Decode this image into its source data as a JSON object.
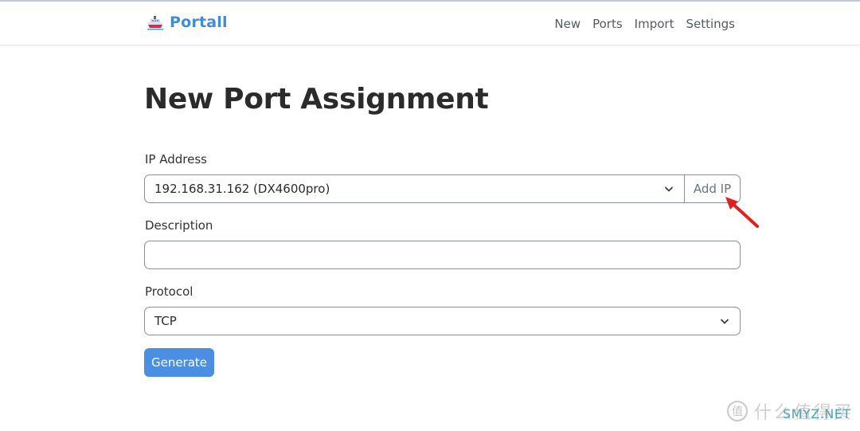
{
  "navbar": {
    "brand": {
      "icon": "ship-icon",
      "label": "Portall"
    },
    "links": [
      {
        "label": "New"
      },
      {
        "label": "Ports"
      },
      {
        "label": "Import"
      },
      {
        "label": "Settings"
      }
    ]
  },
  "page": {
    "title": "New Port Assignment"
  },
  "form": {
    "ip_address": {
      "label": "IP Address",
      "selected": "192.168.31.162 (DX4600pro)",
      "add_button": "Add IP"
    },
    "description": {
      "label": "Description",
      "value": "",
      "placeholder": ""
    },
    "protocol": {
      "label": "Protocol",
      "selected": "TCP"
    },
    "submit": {
      "label": "Generate"
    }
  },
  "annotation": {
    "icon": "red-arrow-icon",
    "color": "#e02020"
  },
  "watermark": {
    "logo": "值",
    "cn_text": "什么值得买",
    "en_text": "SMYZ.NET"
  },
  "colors": {
    "brand": "#3f8be0",
    "primary_button": "#4a8fe3"
  }
}
